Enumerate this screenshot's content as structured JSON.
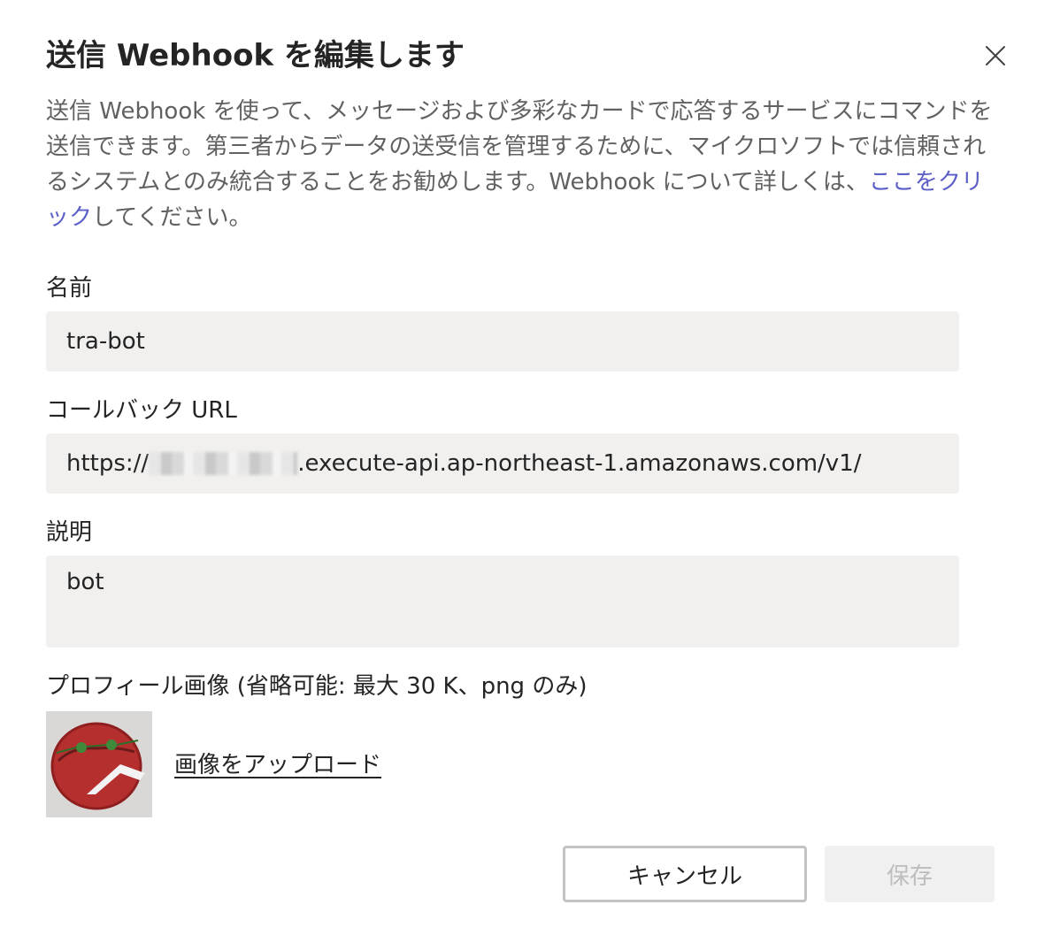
{
  "dialog": {
    "title": "送信 Webhook を編集します",
    "description_before_link": "送信 Webhook を使って、メッセージおよび多彩なカードで応答するサービスにコマンドを送信できます。第三者からデータの送受信を管理するために、マイクロソフトでは信頼されるシステムとのみ統合することをお勧めします。Webhook について詳しくは、",
    "description_link": "ここをクリック",
    "description_after_link": "してください。"
  },
  "form": {
    "name_label": "名前",
    "name_value": "tra-bot",
    "callback_label": "コールバック URL",
    "callback_prefix": "https://",
    "callback_suffix": ".execute-api.ap-northeast-1.amazonaws.com/v1/",
    "description_label": "説明",
    "description_value": "bot",
    "profile_label": "プロフィール画像 (省略可能: 最大 30 K、png のみ)",
    "upload_link": "画像をアップロード"
  },
  "actions": {
    "cancel_label": "キャンセル",
    "save_label": "保存"
  },
  "icons": {
    "close": "close-icon",
    "avatar": "profile-avatar-image"
  },
  "colors": {
    "link": "#5b5fc7",
    "field_bg": "#f1f0ef",
    "disabled_text": "#bdbdbd"
  }
}
